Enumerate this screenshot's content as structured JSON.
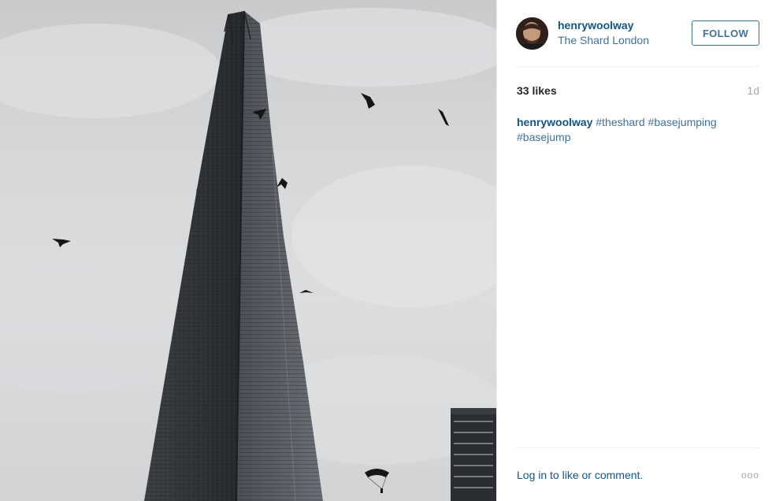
{
  "post": {
    "username": "henrywoolway",
    "location": "The Shard London",
    "follow_label": "FOLLOW",
    "likes": "33 likes",
    "time_ago": "1d",
    "caption_user": "henrywoolway",
    "hashtags": [
      "#theshard",
      "#basejumping",
      "#basejump"
    ],
    "login_prompt": "Log in to like or comment.",
    "more_label": "ooo"
  },
  "photo": {
    "subject": "The Shard skyscraper with birds and a base jumper parachute"
  },
  "colors": {
    "link": "#125688",
    "link_secondary": "#3f729b",
    "muted": "#a5a7aa",
    "divider": "#efefef"
  },
  "icons": {
    "avatar": "user-avatar",
    "more": "more-options-icon"
  }
}
